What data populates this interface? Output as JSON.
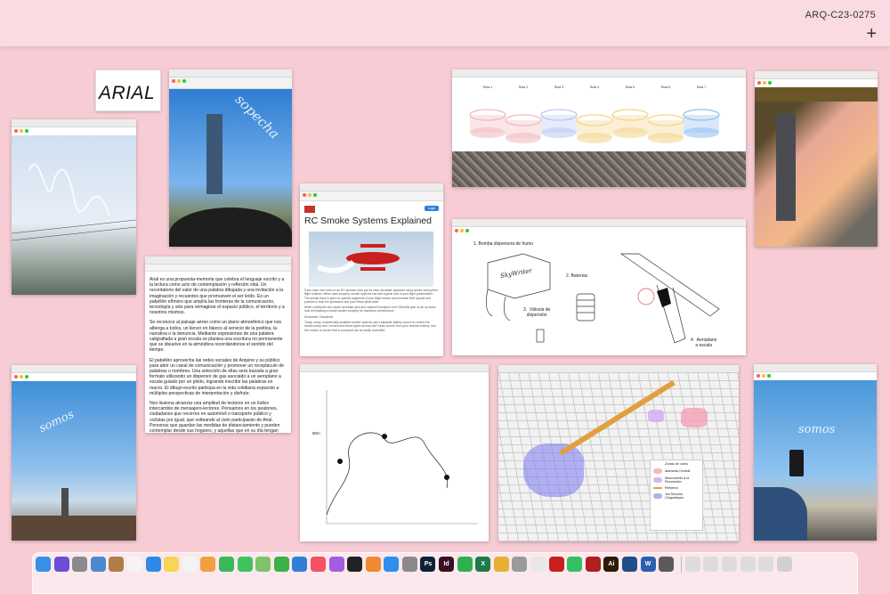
{
  "header": {
    "project_code": "ARQ-C23-0275",
    "add_label": "+"
  },
  "arial_card": {
    "text": "ARIAL"
  },
  "text_doc": {
    "paragraphs": [
      "Arial es una propuesta-memoria que celebra el lenguaje escrito y a la lectura como acto de contemplación y reflexión vital. Un recordatorio del valor de una palabra dibujada y una invitación a la imaginación y recuentos que promueven el ser leído. Es un pabellón efímero que amplía las fronteras de la comunicación, tecnología y arte para reimaginar el espacio público, el territorio y a nosotros mismos.",
      "Se reconoce al paisaje aéreo como un plano atmosférico que nos alberga a todos, un lienzo en blanco al servicio de la poética, la narrativa o la denuncia. Mediante expresiones de una palabra caligrafiada a gran escala se plantea una escritura no permanente que se disuelve en la atmósfera recordándonos el sentido del tiempo.",
      "El pabellón aprovecha las redes sociales de Arquine y su público para abrir un canal de comunicación y promover un receptáculo de palabras o nombres. Una selección de ellas será trazada a gran formato utilizando un dispersor de gas asociado a un aeroplano a escala guiado por un piloto, logrando inscribir las palabras en macro. El dibujo-escrito participa en la vida cotidiana expuesto a múltiples perspectivas de interpretación y disfrute.",
      "Nos ilusiona alcanzar una amplitud de lectores en un lúdico intercambio de mensajero-lectores. Pensamos en los peatones, ciudadanos que recorren en automóvil o transporte público y ciclistas por igual, que volteando al cielo participarán de Arial. Personas que guardan las medidas de distanciamiento y pueden contemplar desde sus hogares, y aquellas que en su día tengan contacto con el paisaje aéreo."
    ]
  },
  "skywriting": {
    "car_photo": "sopecha",
    "blue_photo_left": "somos",
    "blue_photo_right": "somos"
  },
  "rc_article": {
    "title": "RC Smoke Systems Explained",
    "button": "Login",
    "para1": "If you have ever been to an RC airshow, then you've seen aerobatic airplanes using smoke during their flight routines. When used properly, smoke systems can add a great look to your flight presentation. The smoke trace is given to specific segments of your flight routine and increase their appeal and positive to both the spectators and your fellow pilots alike.",
    "para2": "While contributor and expert aerobatic pilot and national champion John Glezellis give us an up-close look at installing a smoke system properly for maximum performance.",
    "para3": "Disclaimer: Disclaimer",
    "para4": "Today, many commercially available smoke systems use a separate battery source to control the smoke pump and I recommend these types as they don't draw current from your receiver battery, and the volume of smoke that is produced can be easily controlled."
  },
  "timeline_window": {
    "labels": [
      "Ruta 1",
      "Ruta 2",
      "Ruta 3",
      "Ruta 4",
      "Ruta 5",
      "Ruta 6",
      "Ruta 7"
    ],
    "colors": [
      "#f0b8bc",
      "#f0b8bc",
      "#b8c8f0",
      "#f3d58a",
      "#f3d58a",
      "#f3d58a",
      "#8fbdf0"
    ]
  },
  "diagram": {
    "label1": "1.   Bomba dispersora de humo",
    "label2": "2.   Baterías",
    "label3": "3.  Válvula de\ndispersión",
    "label4": "4.  Aeroplano\na escala",
    "brand": "SkyWriter"
  },
  "plot": {
    "height_label": "80m"
  },
  "map_legend": {
    "title": "Zonas de vuelo",
    "items": [
      {
        "label": "Alameda Central",
        "color": "#f4b8c4"
      },
      {
        "label": "Monumento a la Revolución",
        "color": "#d9b8e6"
      },
      {
        "label": "Reforma",
        "color": "#e0a040"
      },
      {
        "label": "1ra Sección Chapultepec",
        "color": "#a9b4f0"
      }
    ]
  },
  "dock": {
    "icons": [
      {
        "name": "finder",
        "color": "#3a8fe8"
      },
      {
        "name": "siri",
        "color": "#6b4ed6"
      },
      {
        "name": "launchpad",
        "color": "#8a8a8a"
      },
      {
        "name": "preview",
        "color": "#4a8ad0"
      },
      {
        "name": "notes-brown",
        "color": "#b07d4a"
      },
      {
        "name": "calendar",
        "color": "#f4f4f4"
      },
      {
        "name": "safari",
        "color": "#2e8ae8"
      },
      {
        "name": "notes",
        "color": "#f7d558"
      },
      {
        "name": "reminders",
        "color": "#f4f4f4"
      },
      {
        "name": "photos",
        "color": "#f0a040"
      },
      {
        "name": "messages",
        "color": "#39b85a"
      },
      {
        "name": "facetime",
        "color": "#3fc35f"
      },
      {
        "name": "maps",
        "color": "#7cc46a"
      },
      {
        "name": "numbers",
        "color": "#3db04a"
      },
      {
        "name": "keynote",
        "color": "#2f7fd8"
      },
      {
        "name": "music",
        "color": "#f55068"
      },
      {
        "name": "podcasts",
        "color": "#a45ce0"
      },
      {
        "name": "tv",
        "color": "#222222"
      },
      {
        "name": "books",
        "color": "#f08a30"
      },
      {
        "name": "app-store",
        "color": "#2f8ef0"
      },
      {
        "name": "settings",
        "color": "#8a8a8a"
      },
      {
        "name": "photoshop",
        "color": "#0f1f36",
        "glyph": "Ps"
      },
      {
        "name": "indesign",
        "color": "#3a0f24",
        "glyph": "Id"
      },
      {
        "name": "sketch",
        "color": "#2fb050"
      },
      {
        "name": "excel",
        "color": "#1f7a45",
        "glyph": "X"
      },
      {
        "name": "chrome",
        "color": "#e8b030"
      },
      {
        "name": "scanner",
        "color": "#9a9a9a"
      },
      {
        "name": "feather",
        "color": "#e8e8e8"
      },
      {
        "name": "acrobat",
        "color": "#c8201e"
      },
      {
        "name": "whatsapp",
        "color": "#34c060"
      },
      {
        "name": "acrobat-2",
        "color": "#b02020"
      },
      {
        "name": "illustrator",
        "color": "#2f1a05",
        "glyph": "Ai"
      },
      {
        "name": "quicktime",
        "color": "#1f4f8a"
      },
      {
        "name": "word",
        "color": "#2a5fb0",
        "glyph": "W"
      },
      {
        "name": "screenshot",
        "color": "#5a5a5a"
      },
      {
        "name": "folder-1",
        "color": "#dcdcdc"
      },
      {
        "name": "folder-2",
        "color": "#dcdcdc"
      },
      {
        "name": "folder-3",
        "color": "#dcdcdc"
      },
      {
        "name": "folder-4",
        "color": "#dcdcdc"
      },
      {
        "name": "folder-5",
        "color": "#dcdcdc"
      },
      {
        "name": "trash",
        "color": "#d0d0d0"
      }
    ]
  }
}
